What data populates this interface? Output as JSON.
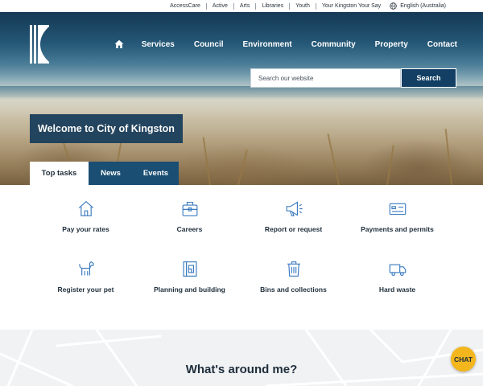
{
  "utility_bar": {
    "links": [
      "AccessCare",
      "Active",
      "Arts",
      "Libraries",
      "Youth",
      "Your Kingston Your Say"
    ],
    "language": "English (Australia)"
  },
  "main_nav": {
    "items": [
      "Services",
      "Council",
      "Environment",
      "Community",
      "Property",
      "Contact"
    ]
  },
  "search": {
    "placeholder": "Search our website",
    "button_label": "Search"
  },
  "hero": {
    "welcome": "Welcome to City of Kingston"
  },
  "tabs": [
    {
      "label": "Top tasks",
      "active": true
    },
    {
      "label": "News",
      "active": false
    },
    {
      "label": "Events",
      "active": false
    }
  ],
  "tasks": [
    {
      "label": "Pay your rates",
      "icon": "house-icon"
    },
    {
      "label": "Careers",
      "icon": "briefcase-icon"
    },
    {
      "label": "Report or request",
      "icon": "megaphone-icon"
    },
    {
      "label": "Payments and permits",
      "icon": "card-icon"
    },
    {
      "label": "Register your pet",
      "icon": "dog-icon"
    },
    {
      "label": "Planning and building",
      "icon": "blueprint-icon"
    },
    {
      "label": "Bins and collections",
      "icon": "bin-icon"
    },
    {
      "label": "Hard waste",
      "icon": "truck-icon"
    }
  ],
  "map_section": {
    "title": "What's around me?"
  },
  "chat": {
    "label": "CHAT"
  },
  "colors": {
    "navy": "#1b3f5c",
    "tab_blue": "#1b4e73",
    "icon_blue": "#3d7cc0",
    "chat_yellow": "#f3b61d"
  }
}
